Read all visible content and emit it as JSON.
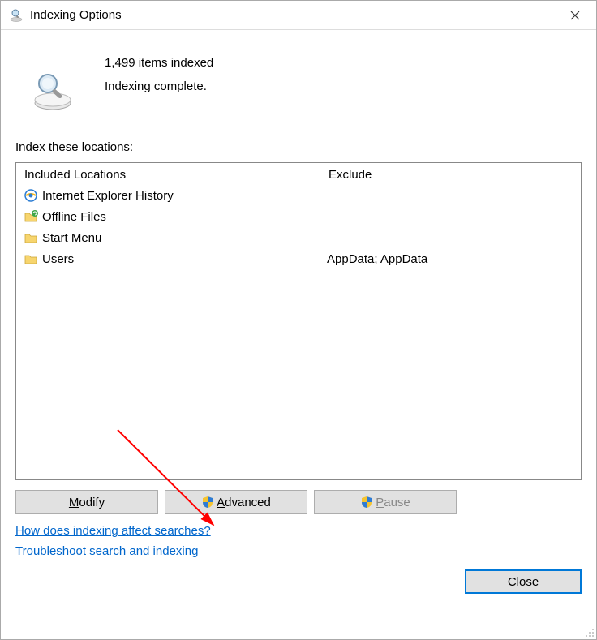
{
  "titlebar": {
    "title": "Indexing Options"
  },
  "status": {
    "count_text": "1,499 items indexed",
    "state_text": "Indexing complete."
  },
  "label": "Index these locations:",
  "columns": {
    "included": "Included Locations",
    "exclude": "Exclude"
  },
  "rows": [
    {
      "label": "Internet Explorer History",
      "exclude": "",
      "icon": "ie"
    },
    {
      "label": "Offline Files",
      "exclude": "",
      "icon": "folder-sync"
    },
    {
      "label": "Start Menu",
      "exclude": "",
      "icon": "folder"
    },
    {
      "label": "Users",
      "exclude": "AppData; AppData",
      "icon": "folder"
    }
  ],
  "buttons": {
    "modify": "Modify",
    "advanced": "Advanced",
    "pause": "Pause",
    "close": "Close"
  },
  "links": {
    "affect": "How does indexing affect searches?",
    "troubleshoot": "Troubleshoot search and indexing"
  }
}
